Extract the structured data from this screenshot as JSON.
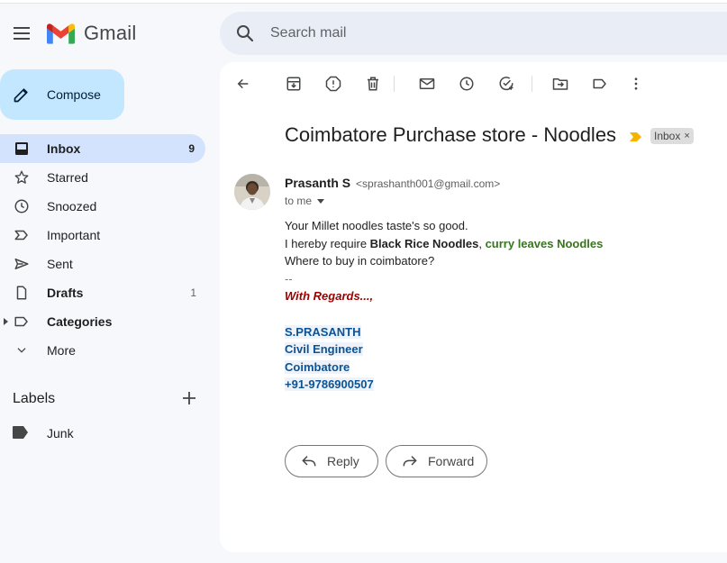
{
  "app": {
    "name": "Gmail"
  },
  "search": {
    "placeholder": "Search mail"
  },
  "compose": {
    "label": "Compose"
  },
  "sidebar": {
    "items": [
      {
        "label": "Inbox",
        "count": "9",
        "icon": "inbox-icon"
      },
      {
        "label": "Starred",
        "count": "",
        "icon": "star-icon"
      },
      {
        "label": "Snoozed",
        "count": "",
        "icon": "clock-icon"
      },
      {
        "label": "Important",
        "count": "",
        "icon": "important-icon"
      },
      {
        "label": "Sent",
        "count": "",
        "icon": "send-icon"
      },
      {
        "label": "Drafts",
        "count": "1",
        "icon": "draft-icon"
      },
      {
        "label": "Categories",
        "count": "",
        "icon": "label-icon"
      },
      {
        "label": "More",
        "count": "",
        "icon": "chevron-down-icon"
      }
    ],
    "labels_title": "Labels",
    "labels": [
      {
        "label": "Junk",
        "icon": "label-filled-icon"
      }
    ]
  },
  "toolbar": {
    "icons": [
      "back-arrow-icon",
      "archive-icon",
      "report-spam-icon",
      "delete-icon",
      "mark-unread-icon",
      "snooze-icon",
      "add-task-icon",
      "move-to-icon",
      "labels-icon",
      "more-vert-icon"
    ]
  },
  "email": {
    "subject": "Coimbatore Purchase store - Noodles",
    "inbox_chip": "Inbox",
    "chip_close": "×",
    "sender_name": "Prasanth S",
    "sender_email": "<sprashanth001@gmail.com>",
    "to": "to me",
    "body": {
      "line1": "Your Millet noodles taste's so good.",
      "line2_prefix": "I hereby require ",
      "line2_bold": "Black Rice Noodles",
      "line2_sep": ", ",
      "line2_green": "curry leaves Noodles",
      "line3": "Where to buy in coimbatore?",
      "dashes": "--",
      "regards": "With Regards...,",
      "sig_name": "S.PRASANTH",
      "sig_title": "Civil Engineer",
      "sig_city": "Coimbatore",
      "sig_phone": "+91-9786900507"
    }
  },
  "actions": {
    "reply": "Reply",
    "forward": "Forward"
  },
  "colors": {
    "active_nav": "#d3e3fd",
    "compose_bg": "#c2e7ff",
    "background": "#f6f8fc",
    "regards": "#990000",
    "signature": "#1155cc",
    "green_text": "#38761d"
  }
}
